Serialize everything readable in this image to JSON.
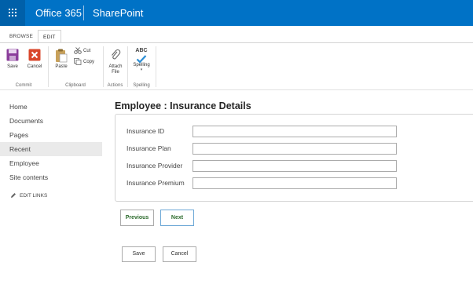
{
  "suitebar": {
    "brand": "Office 365",
    "app": "SharePoint"
  },
  "ribbon": {
    "tabs": [
      "BROWSE",
      "EDIT"
    ],
    "active_tab": "EDIT",
    "groups": {
      "commit": {
        "label": "Commit",
        "save": "Save",
        "cancel": "Cancel"
      },
      "clipboard": {
        "label": "Clipboard",
        "paste": "Paste",
        "cut": "Cut",
        "copy": "Copy"
      },
      "actions": {
        "label": "Actions",
        "attach_line1": "Attach",
        "attach_line2": "File"
      },
      "spelling": {
        "label": "Spelling",
        "abc": "ABC",
        "spelling": "Spelling"
      }
    }
  },
  "leftnav": {
    "items": [
      "Home",
      "Documents",
      "Pages",
      "Recent",
      "Employee",
      "Site contents"
    ],
    "selected": "Recent",
    "edit_links": "EDIT LINKS"
  },
  "main": {
    "title": "Employee : Insurance Details",
    "fields": [
      {
        "label": "Insurance ID",
        "value": ""
      },
      {
        "label": "Insurance Plan",
        "value": ""
      },
      {
        "label": "Insurance Provider",
        "value": ""
      },
      {
        "label": "Insurance Premium",
        "value": ""
      }
    ],
    "previous": "Previous",
    "next": "Next",
    "save": "Save",
    "cancel": "Cancel"
  },
  "colors": {
    "suitebar": "#0072c6",
    "waffle": "#0060a9",
    "wizard_text": "#2b6a2b"
  }
}
